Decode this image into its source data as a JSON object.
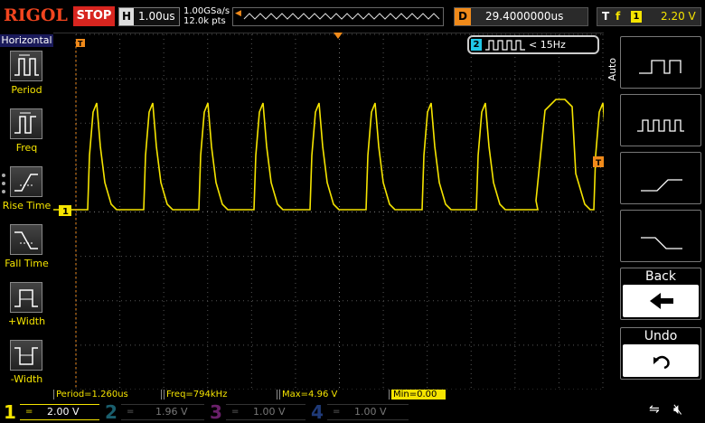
{
  "topbar": {
    "brand": "RIGOL",
    "run_state": "STOP",
    "timebase_label": "H",
    "timebase_value": "1.00us",
    "sample_rate": "1.00GSa/s",
    "mem_depth": "12.0k pts",
    "delay_label": "D",
    "delay_value": "29.4000000us",
    "trigger_label": "T",
    "trigger_edge_icon": "rising-edge-icon",
    "trigger_source": "1",
    "trigger_level": "2.20 V"
  },
  "left_panel": {
    "title": "Horizontal",
    "items": [
      {
        "label": "Period",
        "icon": "period-icon"
      },
      {
        "label": "Freq",
        "icon": "freq-icon"
      },
      {
        "label": "Rise Time",
        "icon": "rise-time-icon"
      },
      {
        "label": "Fall Time",
        "icon": "fall-time-icon"
      },
      {
        "label": "+Width",
        "icon": "pos-width-icon"
      },
      {
        "label": "-Width",
        "icon": "neg-width-icon"
      }
    ]
  },
  "screen": {
    "ch2_badge_num": "2",
    "ch2_badge_freq": "< 15Hz",
    "ch1_marker": "1",
    "trigger_marker": "T"
  },
  "measurements": [
    {
      "text": "Period=1.260us",
      "highlight": false
    },
    {
      "text": "Freq=794kHz",
      "highlight": false
    },
    {
      "text": "Max=4.96 V",
      "highlight": false
    },
    {
      "text": "Min=0.00 V",
      "highlight": true
    }
  ],
  "right_panel": {
    "mode_label": "Auto",
    "buttons": [
      {
        "name": "single-pulse-button",
        "icon": "single-pulse-icon"
      },
      {
        "name": "pulse-train-button",
        "icon": "pulse-train-icon"
      },
      {
        "name": "rising-edge-button",
        "icon": "rising-edge-icon"
      },
      {
        "name": "falling-edge-button",
        "icon": "falling-edge-icon"
      }
    ],
    "back_label": "Back",
    "back_icon": "left-arrow-icon",
    "undo_label": "Undo",
    "undo_icon": "undo-icon"
  },
  "channels": [
    {
      "num": "1",
      "eq": "=",
      "value": "2.00 V",
      "color": "#f5e400",
      "active": true
    },
    {
      "num": "2",
      "eq": "=",
      "value": "1.96 V",
      "color": "#1fc8e8",
      "active": false
    },
    {
      "num": "3",
      "eq": "=",
      "value": "1.00 V",
      "color": "#d43ad4",
      "active": false
    },
    {
      "num": "4",
      "eq": "=",
      "value": "1.00 V",
      "color": "#2d6ee8",
      "active": false
    }
  ],
  "status_icons": [
    "usb-icon",
    "speaker-mute-icon"
  ]
}
